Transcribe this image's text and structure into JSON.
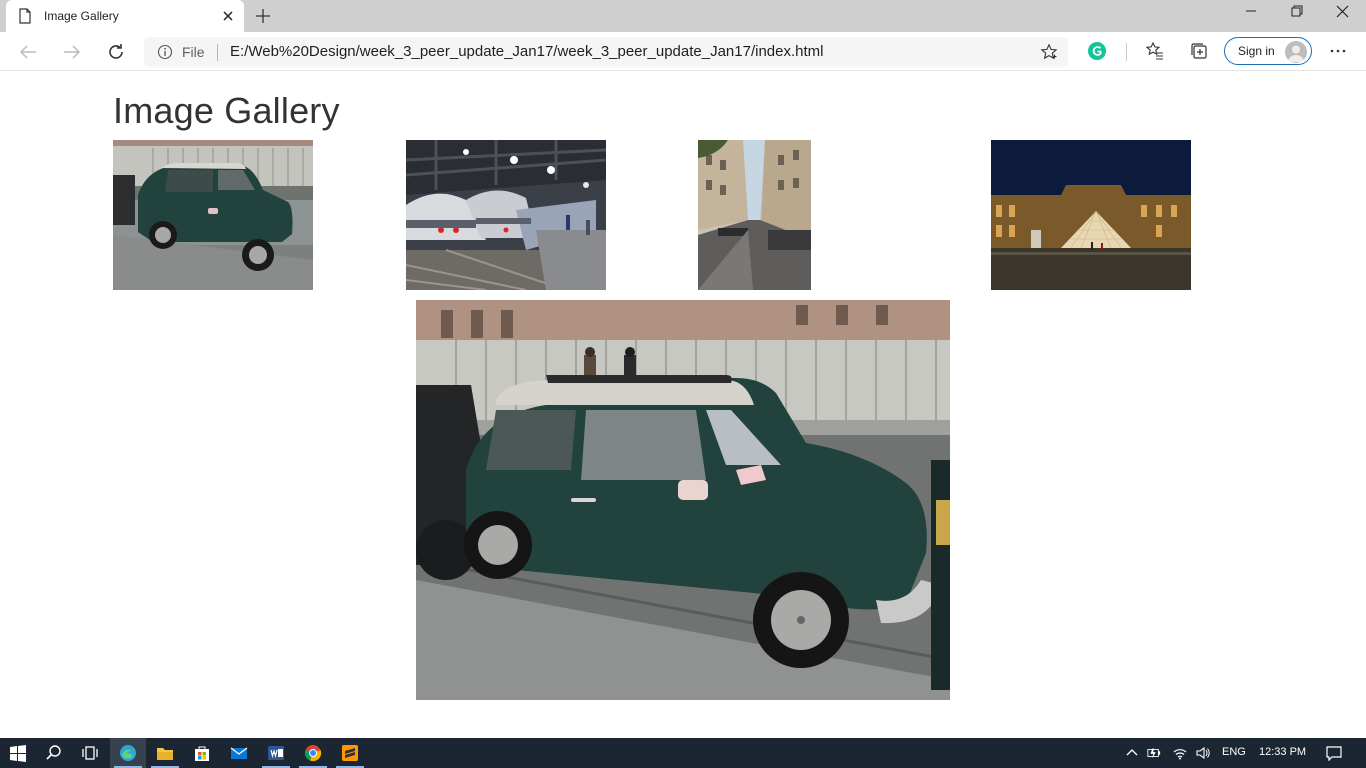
{
  "browser": {
    "tab_title": "Image Gallery",
    "file_label": "File",
    "url": "E:/Web%20Design/week_3_peer_update_Jan17/week_3_peer_update_Jan17/index.html",
    "signin_label": "Sign in"
  },
  "page": {
    "title": "Image Gallery",
    "thumbnails": [
      {
        "name": "mini-car",
        "subject": "Mini car"
      },
      {
        "name": "train-station",
        "subject": "Train station"
      },
      {
        "name": "paris-street",
        "subject": "Paris street"
      },
      {
        "name": "louvre-pyramid",
        "subject": "Louvre pyramid"
      }
    ],
    "main_image": {
      "subject": "Mini car"
    }
  },
  "taskbar": {
    "apps": [
      "start-icon",
      "search-icon",
      "task-view-icon",
      "edge-icon",
      "file-explorer-icon",
      "store-icon",
      "mail-icon",
      "word-icon",
      "chrome-icon",
      "sublime-icon"
    ],
    "language": "ENG",
    "time": "12:33 PM"
  },
  "colors": {
    "signin_border": "#1b6fb5",
    "taskbar_bg": "#1c2633",
    "car_green": "#21423d"
  }
}
